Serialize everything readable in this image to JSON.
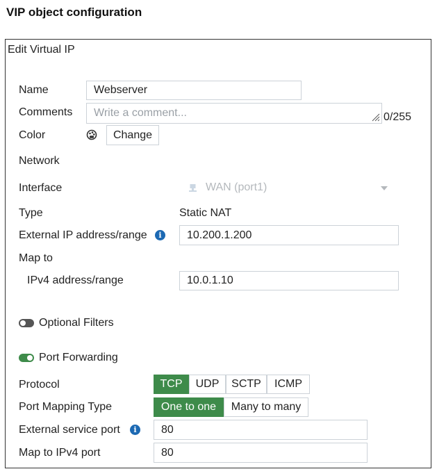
{
  "page_title": "VIP object configuration",
  "panel": {
    "title": "Edit Virtual IP",
    "name": {
      "label": "Name",
      "value": "Webserver"
    },
    "comments": {
      "label": "Comments",
      "placeholder": "Write a comment...",
      "counter": "0/255"
    },
    "color": {
      "label": "Color",
      "button": "Change",
      "icon": "palette-icon"
    },
    "network": {
      "heading": "Network"
    },
    "interface": {
      "label": "Interface",
      "value": "WAN (port1)",
      "icon": "interface-icon"
    },
    "type": {
      "label": "Type",
      "value": "Static NAT"
    },
    "external_ip": {
      "label": "External IP address/range",
      "value": "10.200.1.200"
    },
    "map_to": {
      "heading": "Map to"
    },
    "ipv4_range": {
      "label": "IPv4 address/range",
      "value": "10.0.1.10"
    },
    "optional_filters": {
      "label": "Optional Filters",
      "enabled": false
    },
    "port_forwarding": {
      "label": "Port Forwarding",
      "enabled": true
    },
    "protocol": {
      "label": "Protocol",
      "options": [
        "TCP",
        "UDP",
        "SCTP",
        "ICMP"
      ],
      "selected": "TCP"
    },
    "port_mapping_type": {
      "label": "Port Mapping Type",
      "options": [
        "One to one",
        "Many to many"
      ],
      "selected": "One to one"
    },
    "external_service_port": {
      "label": "External service port",
      "value": "80"
    },
    "map_to_ipv4_port": {
      "label": "Map to IPv4 port",
      "value": "80"
    }
  },
  "colors": {
    "accent_green": "#3e8b4a",
    "info_blue": "#1c69b3"
  }
}
